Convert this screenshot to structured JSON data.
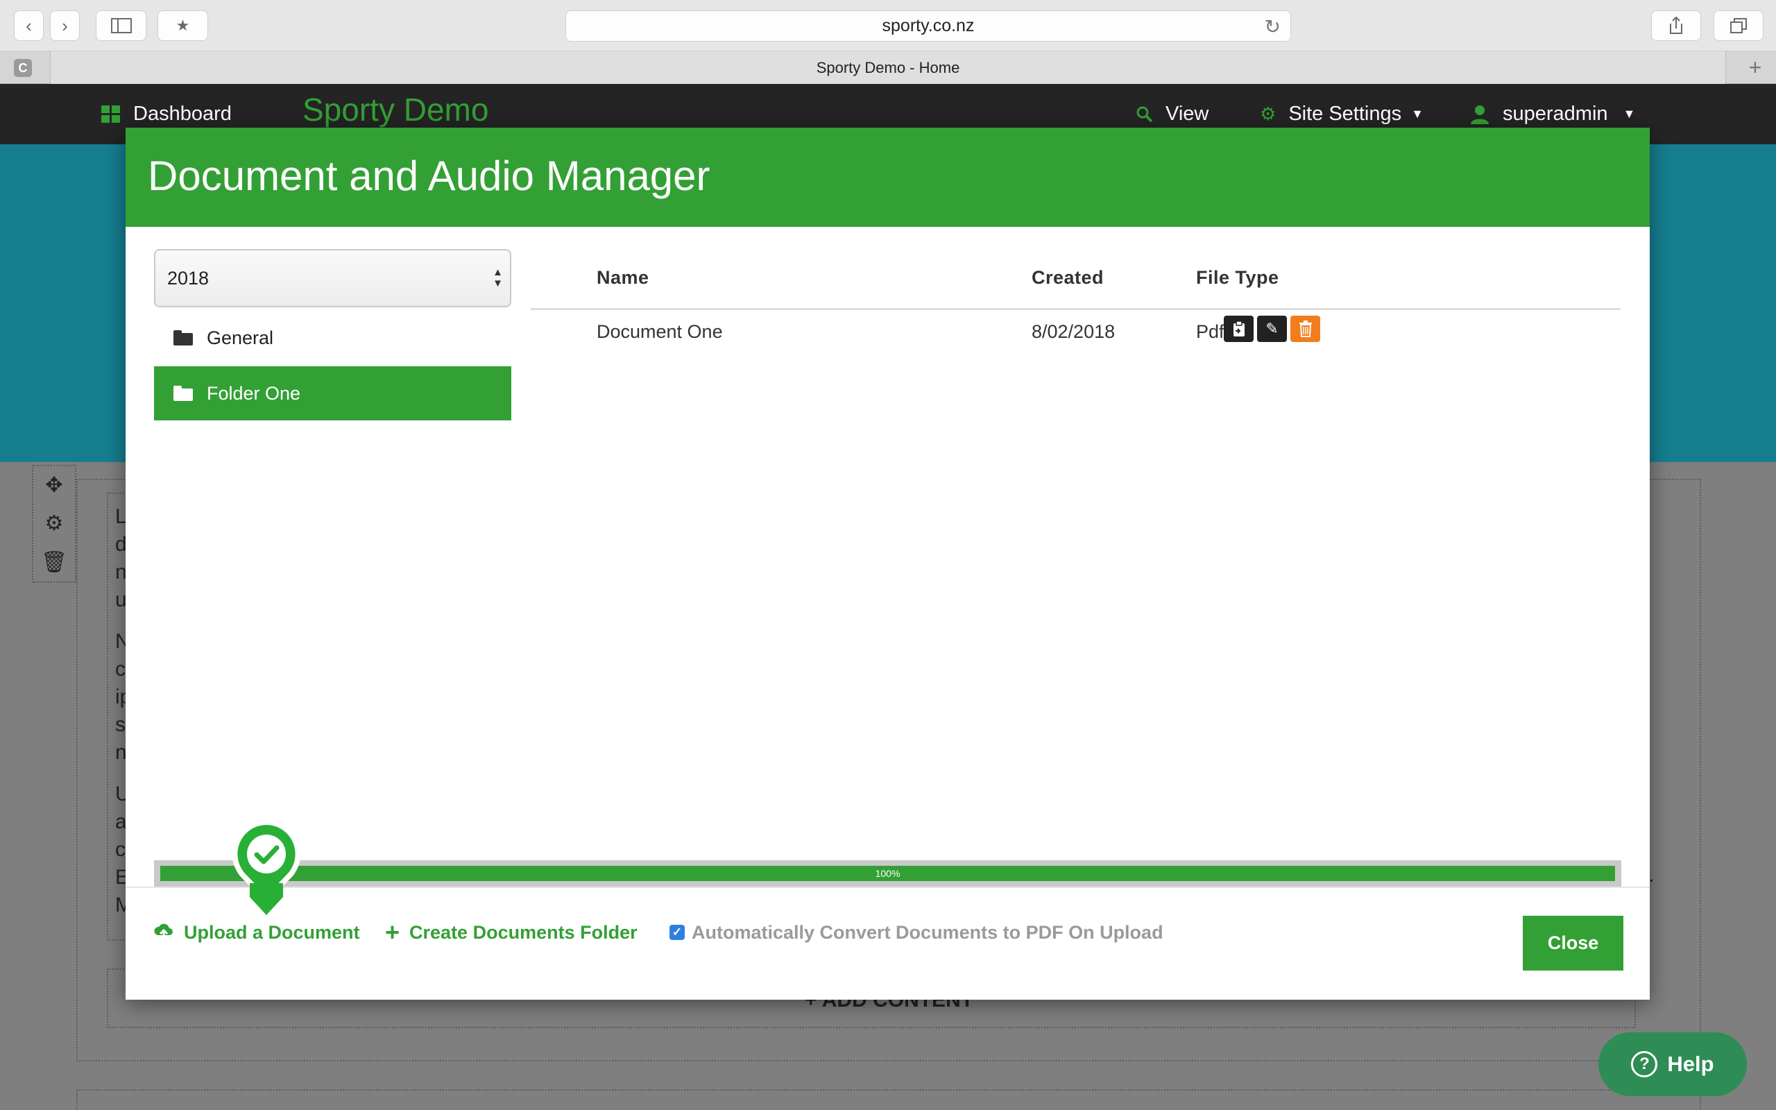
{
  "browser": {
    "url": "sporty.co.nz",
    "tab_title": "Sporty Demo - Home",
    "favicon_letter": "C",
    "icons": [
      "back-icon",
      "forward-icon",
      "sidebar-icon",
      "bookmarks-icon",
      "reload-icon",
      "share-icon",
      "tabs-icon",
      "new-tab-icon"
    ]
  },
  "nav": {
    "dashboard": "Dashboard",
    "brand": "Sporty Demo",
    "view": "View",
    "site_settings": "Site Settings",
    "user": "superadmin"
  },
  "modal": {
    "title": "Document and Audio Manager",
    "year_select": "2018",
    "folders": [
      {
        "label": "General",
        "active": false
      },
      {
        "label": "Folder One",
        "active": true
      }
    ],
    "table": {
      "columns": [
        "Name",
        "Created",
        "File Type"
      ],
      "rows": [
        {
          "name": "Document One",
          "created": "8/02/2018",
          "type": "Pdf"
        }
      ],
      "row_actions": [
        "clipboard-icon",
        "pencil-icon",
        "trash-icon"
      ]
    },
    "progress": {
      "value": 100,
      "label": "100%"
    },
    "footer": {
      "upload": "Upload a Document",
      "create_folder": "Create Documents Folder",
      "auto_convert": "Automatically Convert Documents to PDF On Upload",
      "auto_convert_checked": true,
      "close": "Close"
    }
  },
  "background": {
    "add_content": "+ ADD CONTENT",
    "letters": [
      "L",
      "d",
      "n",
      "u",
      "N",
      "c",
      "ip",
      "s",
      "n",
      "U",
      "a",
      "c",
      "E",
      "M"
    ],
    "right_letters": [
      ";",
      "t."
    ]
  },
  "help": {
    "label": "Help"
  },
  "colors": {
    "brand_green": "#33a035",
    "hero_teal": "#157f90",
    "nav_dark": "#242424",
    "delete_orange": "#f27d1e",
    "help_green": "#2e8c55"
  }
}
